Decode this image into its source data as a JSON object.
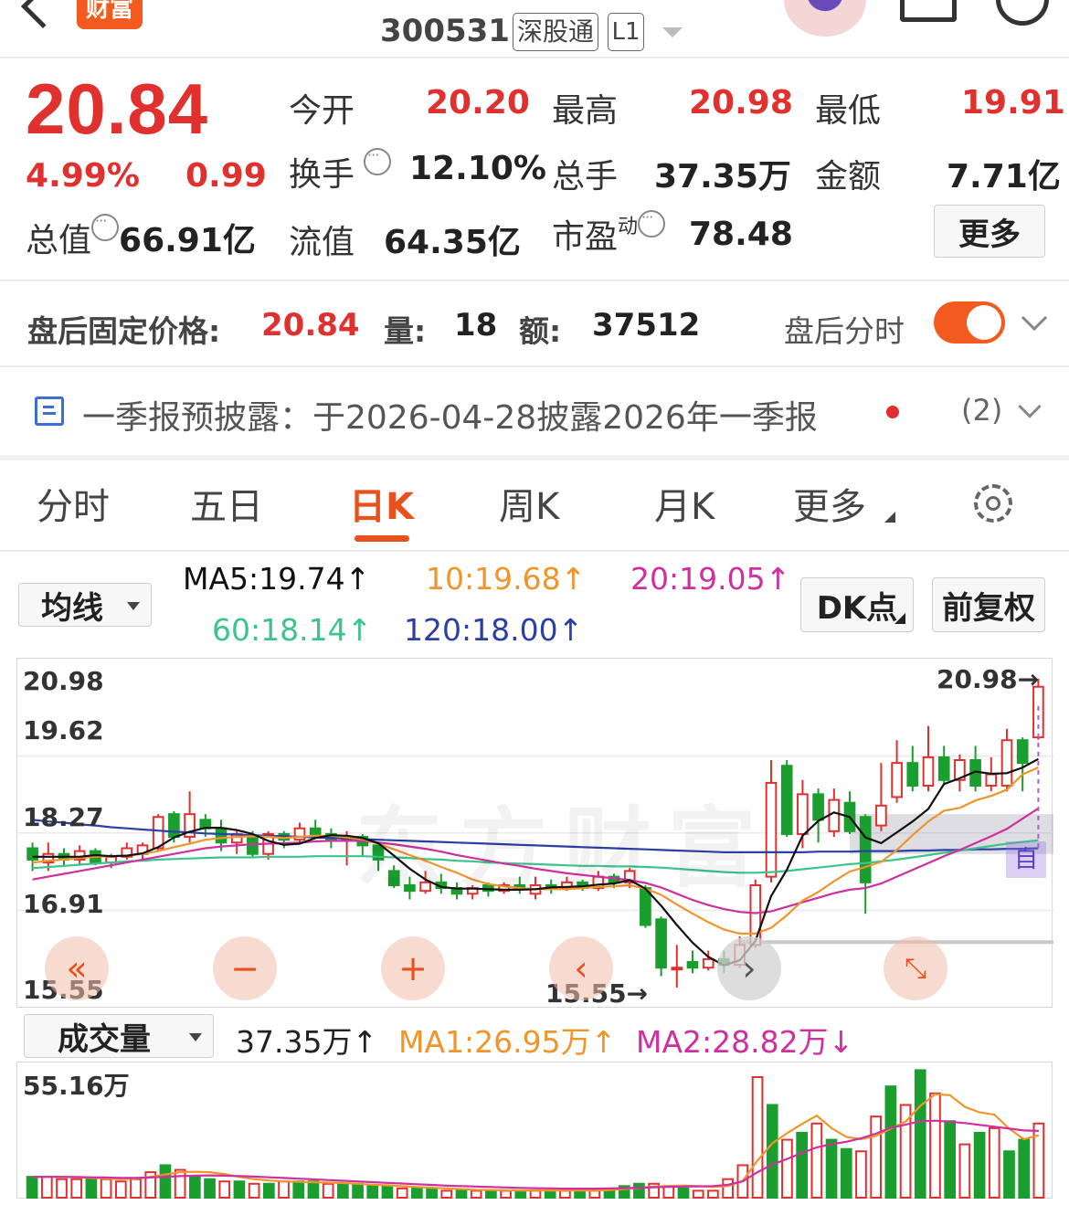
{
  "header": {
    "back_icon": "back-arrow-icon",
    "brand_badge": "财富",
    "stock_code": "300531",
    "tag_connect": "深股通",
    "tag_level": "L1",
    "dropdown_icon": "triangle-down-icon",
    "right_icons": [
      "avatar-icon",
      "share-icon",
      "search-icon"
    ]
  },
  "quote": {
    "price": "20.84",
    "change_pct": "4.99%",
    "change_amt": "0.99",
    "open_label": "今开",
    "open_value": "20.20",
    "high_label": "最高",
    "high_value": "20.98",
    "low_label": "最低",
    "low_value": "19.91",
    "turnover_label": "换手",
    "turnover_value": "12.10%",
    "volume_label": "总手",
    "volume_value": "37.35万",
    "amount_label": "金额",
    "amount_value": "7.71亿",
    "mcap_label": "总值",
    "mcap_value": "66.91亿",
    "float_label": "流值",
    "float_value": "64.35亿",
    "pe_label": "市盈",
    "pe_sup": "动",
    "pe_value": "78.48",
    "more_button": "更多"
  },
  "after_hours": {
    "price_label": "盘后固定价格:",
    "price_value": "20.84",
    "volume_label": "量:",
    "volume_value": "18",
    "amount_label": "额:",
    "amount_value": "37512",
    "toggle_label": "盘后分时",
    "toggle_on": true
  },
  "notice": {
    "icon": "document-icon",
    "text": "一季报预披露：于2026-04-28披露2026年一季报",
    "count": "(2)"
  },
  "chart_tabs": {
    "items": [
      "分时",
      "五日",
      "日K",
      "周K",
      "月K",
      "更多"
    ],
    "active": "日K",
    "settings_icon": "gear-icon"
  },
  "ma_bar": {
    "selector": "均线",
    "ma5": "MA5:19.74↑",
    "ma10": "10:19.68↑",
    "ma20": "20:19.05↑",
    "ma60": "60:18.14↑",
    "ma120": "120:18.00↑",
    "dk_button": "DK点",
    "adjust_button": "前复权"
  },
  "colors": {
    "up": "#e0312f",
    "down": "#1a9e2f",
    "ma5": "#111111",
    "ma10": "#f0952a",
    "ma20": "#cf2f9f",
    "ma60": "#3cc48c",
    "ma120": "#2b3fa6",
    "accent": "#e8511c"
  },
  "kline": {
    "y_labels": [
      "20.98",
      "19.62",
      "18.27",
      "16.91",
      "15.55"
    ],
    "max_marker": "20.98→",
    "min_marker": "15.55→",
    "side_tag": "自",
    "controls": [
      "double-left-icon",
      "minus-icon",
      "plus-icon",
      "left-icon",
      "right-icon",
      "expand-icon"
    ]
  },
  "volume_bar": {
    "selector": "成交量",
    "vol": "37.35万↑",
    "ma1": "MA1:26.95万↑",
    "ma2": "MA2:28.82万↓",
    "y_max": "55.16万"
  },
  "chart_data": {
    "type": "candlestick",
    "ylim": [
      15.55,
      20.98
    ],
    "candles": [
      {
        "o": 18.0,
        "c": 17.8,
        "h": 18.1,
        "l": 17.6
      },
      {
        "o": 17.75,
        "c": 17.9,
        "h": 18.1,
        "l": 17.6
      },
      {
        "o": 17.9,
        "c": 17.8,
        "h": 18.0,
        "l": 17.7
      },
      {
        "o": 17.8,
        "c": 17.95,
        "h": 18.05,
        "l": 17.7
      },
      {
        "o": 17.95,
        "c": 17.75,
        "h": 18.0,
        "l": 17.7
      },
      {
        "o": 17.75,
        "c": 17.85,
        "h": 17.9,
        "l": 17.65
      },
      {
        "o": 17.85,
        "c": 18.0,
        "h": 18.1,
        "l": 17.8
      },
      {
        "o": 17.9,
        "c": 18.05,
        "h": 18.1,
        "l": 17.8
      },
      {
        "o": 18.0,
        "c": 18.55,
        "h": 18.6,
        "l": 17.95
      },
      {
        "o": 18.6,
        "c": 18.2,
        "h": 18.65,
        "l": 18.1
      },
      {
        "o": 18.2,
        "c": 18.6,
        "h": 19.0,
        "l": 18.1
      },
      {
        "o": 18.5,
        "c": 18.35,
        "h": 18.6,
        "l": 18.2
      },
      {
        "o": 18.35,
        "c": 18.1,
        "h": 18.5,
        "l": 17.95
      },
      {
        "o": 18.1,
        "c": 18.25,
        "h": 18.3,
        "l": 17.9
      },
      {
        "o": 18.2,
        "c": 17.9,
        "h": 18.3,
        "l": 17.85
      },
      {
        "o": 17.9,
        "c": 18.25,
        "h": 18.3,
        "l": 17.8
      },
      {
        "o": 18.25,
        "c": 18.15,
        "h": 18.3,
        "l": 18.0
      },
      {
        "o": 18.15,
        "c": 18.35,
        "h": 18.45,
        "l": 18.1
      },
      {
        "o": 18.35,
        "c": 18.25,
        "h": 18.5,
        "l": 18.2
      },
      {
        "o": 18.25,
        "c": 18.15,
        "h": 18.35,
        "l": 18.0
      },
      {
        "o": 18.15,
        "c": 18.2,
        "h": 18.3,
        "l": 17.7
      },
      {
        "o": 18.2,
        "c": 18.05,
        "h": 18.25,
        "l": 17.85
      },
      {
        "o": 18.05,
        "c": 17.8,
        "h": 18.1,
        "l": 17.6
      },
      {
        "o": 17.6,
        "c": 17.35,
        "h": 17.7,
        "l": 17.3
      },
      {
        "o": 17.35,
        "c": 17.25,
        "h": 17.5,
        "l": 17.1
      },
      {
        "o": 17.25,
        "c": 17.4,
        "h": 17.6,
        "l": 17.2
      },
      {
        "o": 17.4,
        "c": 17.3,
        "h": 17.55,
        "l": 17.2
      },
      {
        "o": 17.3,
        "c": 17.2,
        "h": 17.4,
        "l": 17.1
      },
      {
        "o": 17.2,
        "c": 17.3,
        "h": 17.35,
        "l": 17.1
      },
      {
        "o": 17.35,
        "c": 17.25,
        "h": 17.4,
        "l": 17.15
      },
      {
        "o": 17.25,
        "c": 17.35,
        "h": 17.4,
        "l": 17.2
      },
      {
        "o": 17.35,
        "c": 17.3,
        "h": 17.5,
        "l": 17.2
      },
      {
        "o": 17.2,
        "c": 17.35,
        "h": 17.5,
        "l": 17.1
      },
      {
        "o": 17.35,
        "c": 17.3,
        "h": 17.45,
        "l": 17.2
      },
      {
        "o": 17.3,
        "c": 17.4,
        "h": 17.5,
        "l": 17.25
      },
      {
        "o": 17.4,
        "c": 17.3,
        "h": 17.45,
        "l": 17.25
      },
      {
        "o": 17.3,
        "c": 17.5,
        "h": 17.6,
        "l": 17.25
      },
      {
        "o": 17.5,
        "c": 17.4,
        "h": 17.55,
        "l": 17.3
      },
      {
        "o": 17.4,
        "c": 17.6,
        "h": 17.65,
        "l": 17.3
      },
      {
        "o": 17.3,
        "c": 16.65,
        "h": 17.35,
        "l": 16.6
      },
      {
        "o": 16.75,
        "c": 15.9,
        "h": 16.8,
        "l": 15.75
      },
      {
        "o": 15.9,
        "c": 15.9,
        "h": 16.3,
        "l": 15.55
      },
      {
        "o": 16.0,
        "c": 15.9,
        "h": 16.2,
        "l": 15.8
      },
      {
        "o": 15.9,
        "c": 16.05,
        "h": 16.2,
        "l": 15.85
      },
      {
        "o": 16.05,
        "c": 15.95,
        "h": 16.2,
        "l": 15.8
      },
      {
        "o": 15.95,
        "c": 16.3,
        "h": 16.45,
        "l": 15.9
      },
      {
        "o": 16.3,
        "c": 17.35,
        "h": 17.45,
        "l": 16.25
      },
      {
        "o": 17.5,
        "c": 19.15,
        "h": 19.55,
        "l": 17.4
      },
      {
        "o": 19.45,
        "c": 18.25,
        "h": 19.55,
        "l": 18.2
      },
      {
        "o": 18.25,
        "c": 18.95,
        "h": 19.2,
        "l": 18.0
      },
      {
        "o": 18.95,
        "c": 18.5,
        "h": 19.05,
        "l": 18.1
      },
      {
        "o": 18.3,
        "c": 18.85,
        "h": 19.05,
        "l": 18.2
      },
      {
        "o": 18.8,
        "c": 18.3,
        "h": 19.0,
        "l": 18.25
      },
      {
        "o": 18.55,
        "c": 17.4,
        "h": 18.6,
        "l": 16.85
      },
      {
        "o": 18.4,
        "c": 18.75,
        "h": 19.5,
        "l": 18.3
      },
      {
        "o": 18.9,
        "c": 19.5,
        "h": 19.9,
        "l": 18.8
      },
      {
        "o": 19.5,
        "c": 19.1,
        "h": 19.8,
        "l": 19.0
      },
      {
        "o": 19.1,
        "c": 19.6,
        "h": 20.15,
        "l": 19.0
      },
      {
        "o": 19.6,
        "c": 19.2,
        "h": 19.8,
        "l": 19.1
      },
      {
        "o": 19.2,
        "c": 19.55,
        "h": 19.65,
        "l": 19.0
      },
      {
        "o": 19.55,
        "c": 19.1,
        "h": 19.8,
        "l": 19.0
      },
      {
        "o": 19.1,
        "c": 19.3,
        "h": 19.6,
        "l": 19.0
      },
      {
        "o": 19.1,
        "c": 19.9,
        "h": 20.1,
        "l": 19.0
      },
      {
        "o": 19.9,
        "c": 19.5,
        "h": 19.95,
        "l": 19.0
      },
      {
        "o": 19.95,
        "c": 20.84,
        "h": 20.98,
        "l": 19.91
      }
    ],
    "ma5_line": [
      17.85,
      17.85,
      17.85,
      17.85,
      17.88,
      17.86,
      17.87,
      17.91,
      18.02,
      18.19,
      18.29,
      18.36,
      18.36,
      18.32,
      18.25,
      18.13,
      18.06,
      18.08,
      18.18,
      18.23,
      18.22,
      18.18,
      18.09,
      17.87,
      17.64,
      17.45,
      17.32,
      17.29,
      17.29,
      17.28,
      17.27,
      17.27,
      17.28,
      17.31,
      17.32,
      17.33,
      17.36,
      17.38,
      17.44,
      17.29,
      16.99,
      16.65,
      16.34,
      16.09,
      15.94,
      16.03,
      16.37,
      17.16,
      17.62,
      18.22,
      18.48,
      18.63,
      18.55,
      18.19,
      18.09,
      18.28,
      18.47,
      18.69,
      19.13,
      19.23,
      19.35,
      19.31,
      19.32,
      19.42,
      19.57
    ],
    "ma10_line": [
      17.75,
      17.78,
      17.8,
      17.83,
      17.85,
      17.86,
      17.87,
      17.9,
      17.95,
      18.02,
      18.08,
      18.15,
      18.18,
      18.2,
      18.21,
      18.2,
      18.18,
      18.2,
      18.22,
      18.22,
      18.19,
      18.16,
      18.08,
      17.98,
      17.88,
      17.78,
      17.67,
      17.57,
      17.45,
      17.37,
      17.33,
      17.3,
      17.28,
      17.28,
      17.28,
      17.3,
      17.32,
      17.33,
      17.35,
      17.29,
      17.18,
      17.01,
      16.85,
      16.7,
      16.57,
      16.5,
      16.5,
      16.6,
      16.82,
      17.08,
      17.23,
      17.42,
      17.59,
      17.67,
      17.76,
      17.97,
      18.23,
      18.47,
      18.66,
      18.71,
      18.84,
      18.92,
      19.03,
      19.3,
      19.42
    ],
    "ma20_line": [
      17.45,
      17.5,
      17.55,
      17.6,
      17.65,
      17.7,
      17.75,
      17.8,
      17.85,
      17.9,
      17.95,
      18.0,
      18.03,
      18.05,
      18.07,
      18.08,
      18.09,
      18.1,
      18.12,
      18.13,
      18.13,
      18.13,
      18.1,
      18.07,
      18.03,
      17.99,
      17.94,
      17.88,
      17.83,
      17.78,
      17.73,
      17.69,
      17.64,
      17.6,
      17.56,
      17.53,
      17.5,
      17.47,
      17.44,
      17.39,
      17.31,
      17.2,
      17.09,
      17.0,
      16.93,
      16.88,
      16.86,
      16.89,
      16.97,
      17.05,
      17.13,
      17.21,
      17.27,
      17.3,
      17.38,
      17.5,
      17.62,
      17.74,
      17.86,
      17.97,
      18.09,
      18.21,
      18.34,
      18.52,
      18.7
    ],
    "ma60_line": [
      17.65,
      17.67,
      17.69,
      17.71,
      17.73,
      17.75,
      17.77,
      17.78,
      17.8,
      17.81,
      17.82,
      17.83,
      17.84,
      17.84,
      17.84,
      17.85,
      17.85,
      17.85,
      17.86,
      17.86,
      17.86,
      17.86,
      17.85,
      17.84,
      17.83,
      17.81,
      17.8,
      17.78,
      17.77,
      17.75,
      17.74,
      17.73,
      17.72,
      17.71,
      17.7,
      17.69,
      17.69,
      17.68,
      17.68,
      17.67,
      17.66,
      17.64,
      17.62,
      17.6,
      17.58,
      17.57,
      17.57,
      17.58,
      17.6,
      17.63,
      17.66,
      17.69,
      17.72,
      17.74,
      17.77,
      17.8,
      17.84,
      17.88,
      17.92,
      17.96,
      18.0,
      18.04,
      18.08,
      18.11,
      18.14
    ],
    "ma120_line": [
      18.5,
      18.47,
      18.45,
      18.42,
      18.4,
      18.37,
      18.35,
      18.33,
      18.31,
      18.29,
      18.28,
      18.26,
      18.25,
      18.24,
      18.23,
      18.22,
      18.21,
      18.2,
      18.19,
      18.18,
      18.17,
      18.16,
      18.15,
      18.14,
      18.13,
      18.12,
      18.11,
      18.1,
      18.09,
      18.08,
      18.07,
      18.06,
      18.05,
      18.04,
      18.03,
      18.02,
      18.01,
      18.0,
      17.99,
      17.98,
      17.97,
      17.96,
      17.95,
      17.94,
      17.93,
      17.93,
      17.93,
      17.93,
      17.93,
      17.93,
      17.94,
      17.94,
      17.94,
      17.95,
      17.95,
      17.95,
      17.96,
      17.96,
      17.97,
      17.97,
      17.98,
      17.98,
      17.99,
      17.99,
      18.0
    ],
    "volume": [
      9,
      9,
      8,
      8,
      8,
      8,
      7,
      8,
      11,
      14,
      12,
      9,
      8,
      7,
      7,
      6,
      6,
      7,
      7,
      7,
      6,
      6,
      6,
      5,
      5,
      4,
      4,
      4,
      3,
      3,
      3,
      3,
      3,
      3,
      3,
      3,
      3,
      3,
      3,
      3,
      5,
      6,
      6,
      5,
      4,
      3,
      3,
      8,
      14,
      52,
      40,
      25,
      28,
      32,
      25,
      21,
      20,
      35,
      48,
      40,
      55,
      45,
      33,
      23,
      28,
      30,
      20,
      25,
      32
    ],
    "vol_up": [
      0,
      1,
      1,
      1,
      0,
      1,
      1,
      1,
      1,
      0,
      1,
      0,
      0,
      1,
      0,
      1,
      0,
      1,
      0,
      0,
      1,
      0,
      0,
      0,
      0,
      1,
      0,
      0,
      1,
      0,
      1,
      0,
      1,
      0,
      1,
      0,
      1,
      0,
      1,
      0,
      0,
      0,
      1,
      1,
      0,
      1,
      1,
      1,
      1,
      1,
      0,
      1,
      0,
      1,
      0,
      0,
      1,
      1,
      0,
      1,
      0,
      1,
      0,
      1,
      0,
      1,
      0,
      0,
      1
    ],
    "vol_ma1": [
      9,
      9,
      9,
      8.8,
      8.5,
      8.3,
      8,
      8.2,
      9,
      10,
      11,
      11.2,
      11,
      10.2,
      9,
      8,
      7.4,
      7,
      6.8,
      6.6,
      6.5,
      6.3,
      6,
      5.6,
      5.3,
      5,
      4.6,
      4.3,
      4,
      3.7,
      3.4,
      3.3,
      3.2,
      3.1,
      3.1,
      3.1,
      3.1,
      3.1,
      3.1,
      3.3,
      3.7,
      4.2,
      4.8,
      5.1,
      5.2,
      5,
      4.6,
      5,
      7.2,
      16,
      23.4,
      27.8,
      31.8,
      35.4,
      30,
      26.2,
      25.2,
      26.6,
      29.8,
      32.8,
      39.6,
      44.6,
      44.2,
      39.2,
      36.8,
      35.8,
      29.8,
      25.2,
      26.95
    ],
    "vol_ma2": [
      9,
      9,
      9,
      8.9,
      8.8,
      8.7,
      8.5,
      8.5,
      8.7,
      9,
      9.3,
      9.5,
      9.6,
      9.5,
      9.3,
      9.1,
      8.8,
      8.5,
      8.2,
      7.9,
      7.6,
      7.3,
      7,
      6.7,
      6.4,
      6.1,
      5.8,
      5.5,
      5.2,
      5,
      4.8,
      4.6,
      4.4,
      4.2,
      4.1,
      4,
      3.9,
      3.9,
      3.9,
      4,
      4.1,
      4.3,
      4.5,
      4.7,
      4.8,
      4.9,
      5,
      5.6,
      7,
      11,
      14.3,
      16.7,
      19.3,
      21.7,
      23.1,
      24.1,
      25.6,
      27.6,
      30.2,
      31.5,
      33,
      33.2,
      32.8,
      32.2,
      31.4,
      30.6,
      29.8,
      29,
      28.82
    ]
  },
  "watermark": "东方财富"
}
